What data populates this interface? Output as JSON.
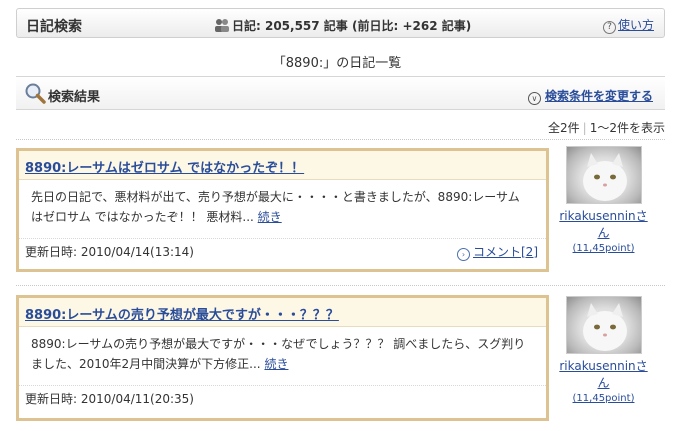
{
  "header": {
    "title": "日記検索",
    "count_text": "日記: 205,557 記事 (前日比: +262 記事)",
    "help_label": "使い方"
  },
  "list_heading": "「8890:」の日記一覧",
  "results": {
    "title": "検索結果",
    "change_label": "検索条件を変更する",
    "total": "全2件",
    "range": "1〜2件を表示"
  },
  "entries": [
    {
      "title": "8890:レーサムはゼロサム ではなかったぞ！！",
      "excerpt_line1": "先日の日記で、悪材料が出て、売り予想が最大に・・・・と書きましたが、8890:レーサム",
      "excerpt_line2": "はゼロサム ではなかったぞ！！ 悪材料...",
      "more_label": "続き",
      "updated": "更新日時: 2010/04/14(13:14)",
      "comment_label": "コメント[2]",
      "user": {
        "name": "rikakusenninさん",
        "point": "(11,45point)"
      }
    },
    {
      "title": "8890:レーサムの売り予想が最大ですが・・・？？？",
      "excerpt_line1": "8890:レーサムの売り予想が最大ですが・・・なぜでしょう？？？ 調べましたら、スグ判り",
      "excerpt_line2": "ました、2010年2月中間決算が下方修正...",
      "more_label": "続き",
      "updated": "更新日時: 2010/04/11(20:35)",
      "comment_label": "",
      "user": {
        "name": "rikakusenninさん",
        "point": "(11,45point)"
      }
    }
  ]
}
